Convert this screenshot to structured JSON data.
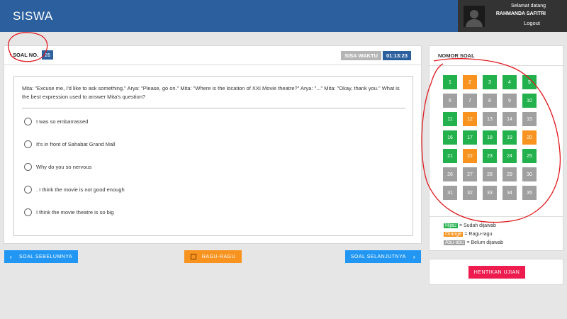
{
  "header": {
    "app_title": "SISWA",
    "greeting": "Selamat datang",
    "user_name": "RAHMANDA SAFITRI",
    "logout": "Logout"
  },
  "question": {
    "number_label": "SOAL NO.",
    "number": "26",
    "timer_label": "SISA WAKTU",
    "timer_value": "01:13:23",
    "text": "Mita: \"Excuse me, I'd like to ask something.\" Arya: \"Please, go on.\" Mita: \"Where is the location of XXI Movie theatre?\" Arya: \"...\" Mita: \"Okay, thank you.\" What is the best expression used to answer Mita's question?",
    "options": [
      "I was so embarrassed",
      "It's in front of Sahabat Grand Mall",
      "Why do you so nervous",
      ". I think the movie is not good enough",
      "I think the movie theatre is so big"
    ]
  },
  "nav_buttons": {
    "prev": "SOAL SEBELUMNYA",
    "ragu": "RAGU-RAGU",
    "next": "SOAL SELANJUTNYA"
  },
  "number_panel": {
    "title": "NOMOR SOAL",
    "numbers": [
      {
        "n": "1",
        "status": "answered"
      },
      {
        "n": "2",
        "status": "doubt"
      },
      {
        "n": "3",
        "status": "answered"
      },
      {
        "n": "4",
        "status": "answered"
      },
      {
        "n": "5",
        "status": "answered"
      },
      {
        "n": "6",
        "status": "empty"
      },
      {
        "n": "7",
        "status": "empty"
      },
      {
        "n": "8",
        "status": "empty"
      },
      {
        "n": "9",
        "status": "empty"
      },
      {
        "n": "10",
        "status": "answered"
      },
      {
        "n": "11",
        "status": "answered"
      },
      {
        "n": "12",
        "status": "doubt"
      },
      {
        "n": "13",
        "status": "empty"
      },
      {
        "n": "14",
        "status": "empty"
      },
      {
        "n": "15",
        "status": "empty"
      },
      {
        "n": "16",
        "status": "answered"
      },
      {
        "n": "17",
        "status": "answered"
      },
      {
        "n": "18",
        "status": "answered"
      },
      {
        "n": "19",
        "status": "answered"
      },
      {
        "n": "20",
        "status": "doubt"
      },
      {
        "n": "21",
        "status": "answered"
      },
      {
        "n": "22",
        "status": "doubt"
      },
      {
        "n": "23",
        "status": "answered"
      },
      {
        "n": "24",
        "status": "answered"
      },
      {
        "n": "25",
        "status": "answered"
      },
      {
        "n": "26",
        "status": "empty"
      },
      {
        "n": "27",
        "status": "empty"
      },
      {
        "n": "28",
        "status": "empty"
      },
      {
        "n": "29",
        "status": "empty"
      },
      {
        "n": "30",
        "status": "empty"
      },
      {
        "n": "31",
        "status": "empty"
      },
      {
        "n": "32",
        "status": "empty"
      },
      {
        "n": "33",
        "status": "empty"
      },
      {
        "n": "34",
        "status": "empty"
      },
      {
        "n": "35",
        "status": "empty"
      }
    ],
    "legend": [
      {
        "tag": "Hijau",
        "text": "= Sudah dijawab",
        "status": "answered"
      },
      {
        "tag": "Orange",
        "text": "= Ragu-ragu",
        "status": "doubt"
      },
      {
        "tag": "Abu-abu",
        "text": "= Belum dijawab",
        "status": "empty"
      }
    ]
  },
  "stop_button": "HENTIKAN UJIAN",
  "colors": {
    "answered": "#22b14c",
    "doubt": "#f7931e",
    "empty": "#a0a0a0",
    "primary": "#2b5f9e",
    "button_blue": "#2196f3",
    "stop_red": "#ee1c4e",
    "annotation": "#e0191e"
  }
}
